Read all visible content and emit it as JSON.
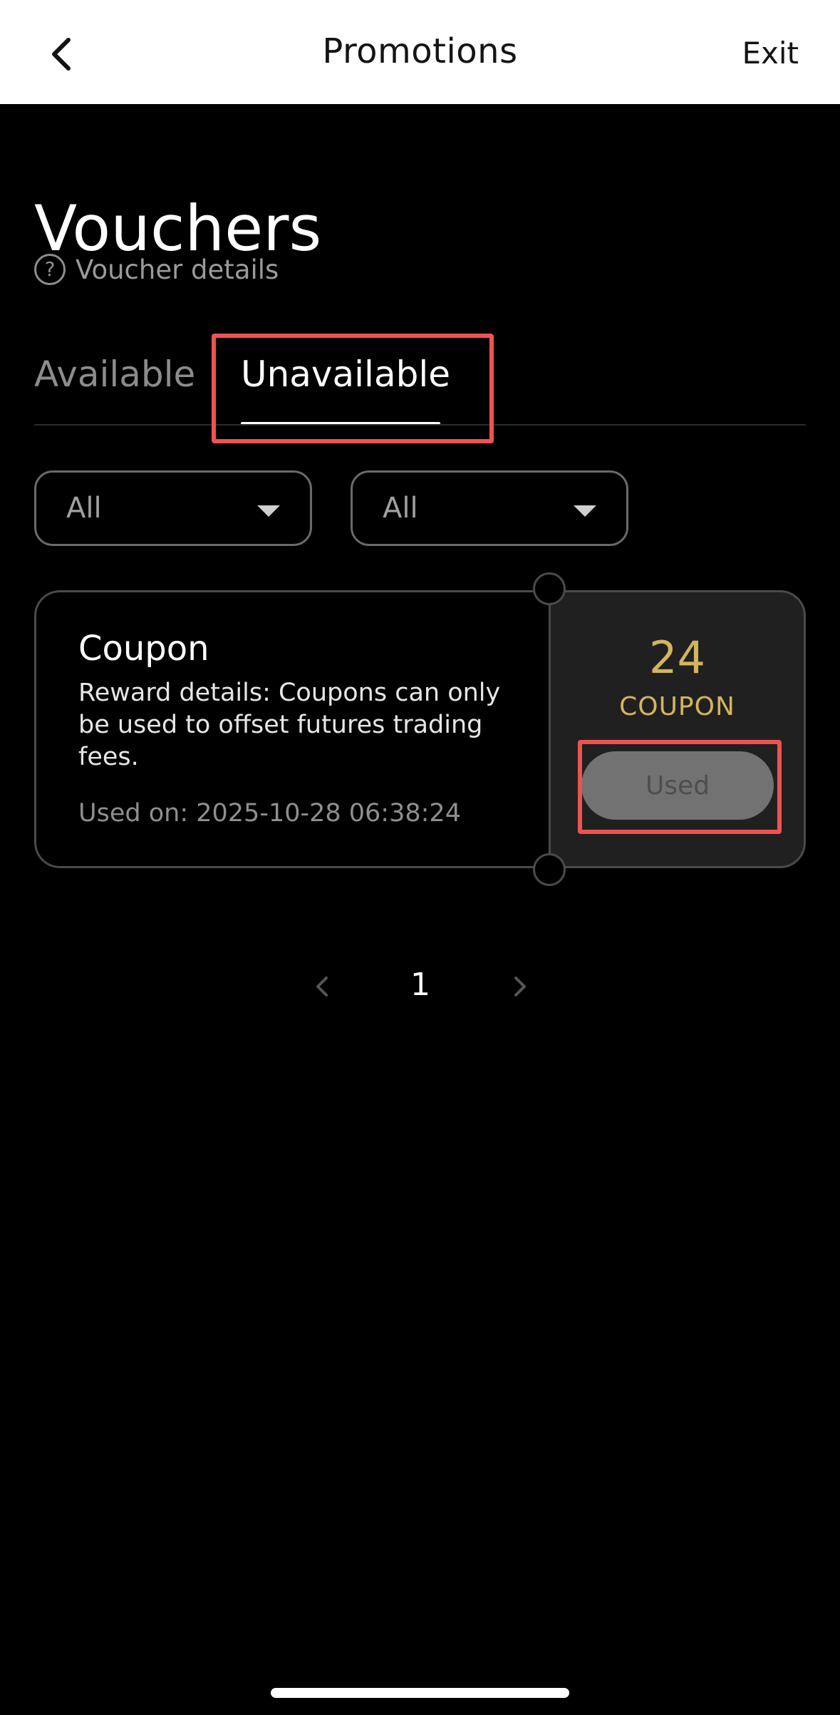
{
  "topbar": {
    "title": "Promotions",
    "exit_label": "Exit",
    "back_icon": "chevron-left-icon"
  },
  "page": {
    "title": "Vouchers",
    "details_link": "Voucher details",
    "details_icon": "question-circle-icon"
  },
  "tabs": [
    {
      "label": "Available",
      "active": false
    },
    {
      "label": "Unavailable",
      "active": true
    }
  ],
  "filters": [
    {
      "value": "All",
      "icon": "caret-down-icon"
    },
    {
      "value": "All",
      "icon": "caret-down-icon"
    }
  ],
  "coupon": {
    "title": "Coupon",
    "description": "Reward details: Coupons can only be used to offset futures trading fees.",
    "used_on": "Used on: 2025-10-28 06:38:24",
    "amount": "24",
    "unit": "COUPON",
    "status_button": "Used"
  },
  "pagination": {
    "current_page": "1",
    "prev_icon": "chevron-left-icon",
    "next_icon": "chevron-right-icon"
  },
  "colors": {
    "accent_gold": "#d4b45e",
    "highlight_red": "#ef5350",
    "background": "#000000"
  }
}
